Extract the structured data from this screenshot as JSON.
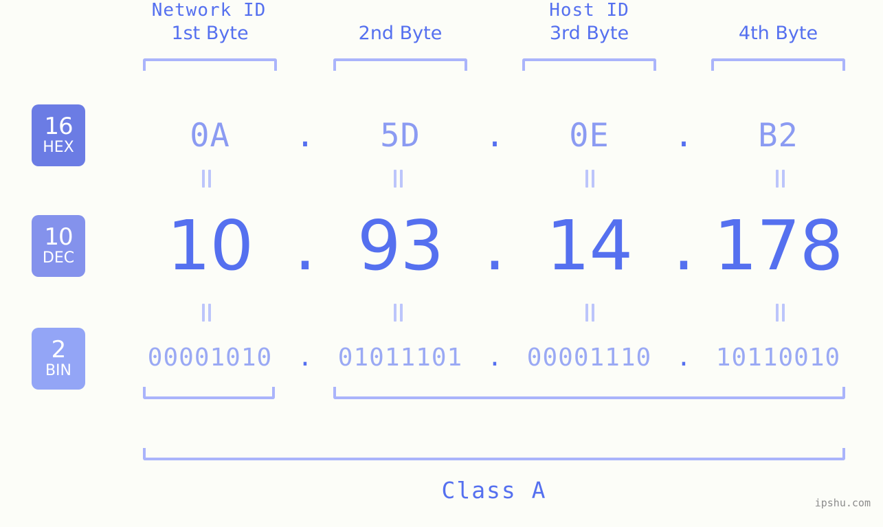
{
  "background_color": "#fcfdf8",
  "accent_colors": {
    "primary": "#5570ef",
    "light": "#8b9bf2",
    "lighter": "#9aa9f4",
    "bracket": "#aab4fb",
    "eq_bar": "#bcc5fb",
    "badge_hex": "#6b7ce4",
    "badge_dec": "#8492ec",
    "badge_bin": "#93a5f6"
  },
  "byte_headers": [
    {
      "label": "1st Byte"
    },
    {
      "label": "2nd Byte"
    },
    {
      "label": "3rd Byte"
    },
    {
      "label": "4th Byte"
    }
  ],
  "bases": [
    {
      "number": "16",
      "unit": "HEX"
    },
    {
      "number": "10",
      "unit": "DEC"
    },
    {
      "number": "2",
      "unit": "BIN"
    }
  ],
  "separator": ".",
  "rows": {
    "hex": {
      "values": [
        "0A",
        "5D",
        "0E",
        "B2"
      ]
    },
    "dec": {
      "values": [
        "10",
        "93",
        "14",
        "178"
      ]
    },
    "bin": {
      "values": [
        "00001010",
        "01011101",
        "00001110",
        "10110010"
      ]
    }
  },
  "equality_mark": "=",
  "segments": {
    "network_id": "Network ID",
    "host_id": "Host ID",
    "class": "Class A"
  },
  "watermark": "ipshu.com"
}
